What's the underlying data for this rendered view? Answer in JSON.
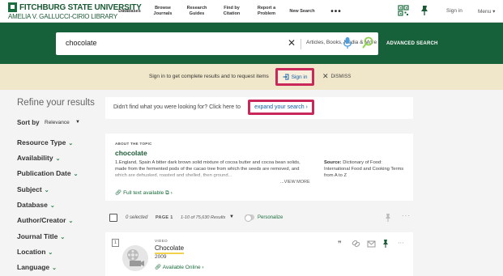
{
  "header": {
    "logo_line1": "FITCHBURG STATE UNIVERSITY",
    "logo_line2": "AMELIA V. GALLUCCI-CIRIO LIBRARY",
    "nav": [
      {
        "label": "Databases"
      },
      {
        "label": "Browse Journals"
      },
      {
        "label": "Research Guides"
      },
      {
        "label": "Find by Citation"
      },
      {
        "label": "Report a Problem"
      },
      {
        "label": "New Search"
      },
      {
        "label": "•••"
      }
    ],
    "signin": "Sign in",
    "menu": "Menu ▾",
    "icons": [
      "qr-code-icon",
      "pin-icon"
    ]
  },
  "search": {
    "query": "chocolate",
    "scope": "Articles, Books, Media & More",
    "advanced": "ADVANCED SEARCH"
  },
  "signin_bar": {
    "message": "Sign in to get complete results and to request items",
    "button": "Sign in",
    "dismiss": "DISMISS"
  },
  "sidebar": {
    "title": "Refine your results",
    "sort_label": "Sort by",
    "sort_value": "Relevance",
    "facets": [
      {
        "label": "Resource Type"
      },
      {
        "label": "Availability"
      },
      {
        "label": "Publication Date"
      },
      {
        "label": "Subject"
      },
      {
        "label": "Database"
      },
      {
        "label": "Author/Creator"
      },
      {
        "label": "Journal Title"
      },
      {
        "label": "Location"
      },
      {
        "label": "Language"
      }
    ]
  },
  "hint": {
    "text": "Didn't find what you were looking for? Click here to",
    "link": "expand your search"
  },
  "topic": {
    "heading": "ABOUT THE TOPIC",
    "title": "chocolate",
    "description": "1.England, Spain A bitter dark brown solid mixture of cocoa butter and cocoa bean solids, made from the fermented pods of the cacao tree from which the seeds are removed, and which are dehusked, roasted and shelled, then ground...",
    "view_more": "...VIEW MORE",
    "source_label": "Source:",
    "source_text": "Dictionary of Food: International Food and Cooking Terms from A to Z",
    "fulltext": "Full text available"
  },
  "results_toolbar": {
    "selected": "0 selected",
    "page": "PAGE 1",
    "range": "1-10 of 75,630 Results",
    "personalize": "Personalize"
  },
  "result": {
    "number": "1",
    "type": "VIDEO",
    "title": "Chocolate",
    "year": "2009",
    "availability": "Available Online"
  },
  "colors": {
    "brand_green": "#17613a",
    "signin_bar_bg": "#f0e6c9",
    "highlight_border": "#c8285a",
    "link_blue": "#0c5fa8",
    "available_green": "#1a6d3c"
  }
}
